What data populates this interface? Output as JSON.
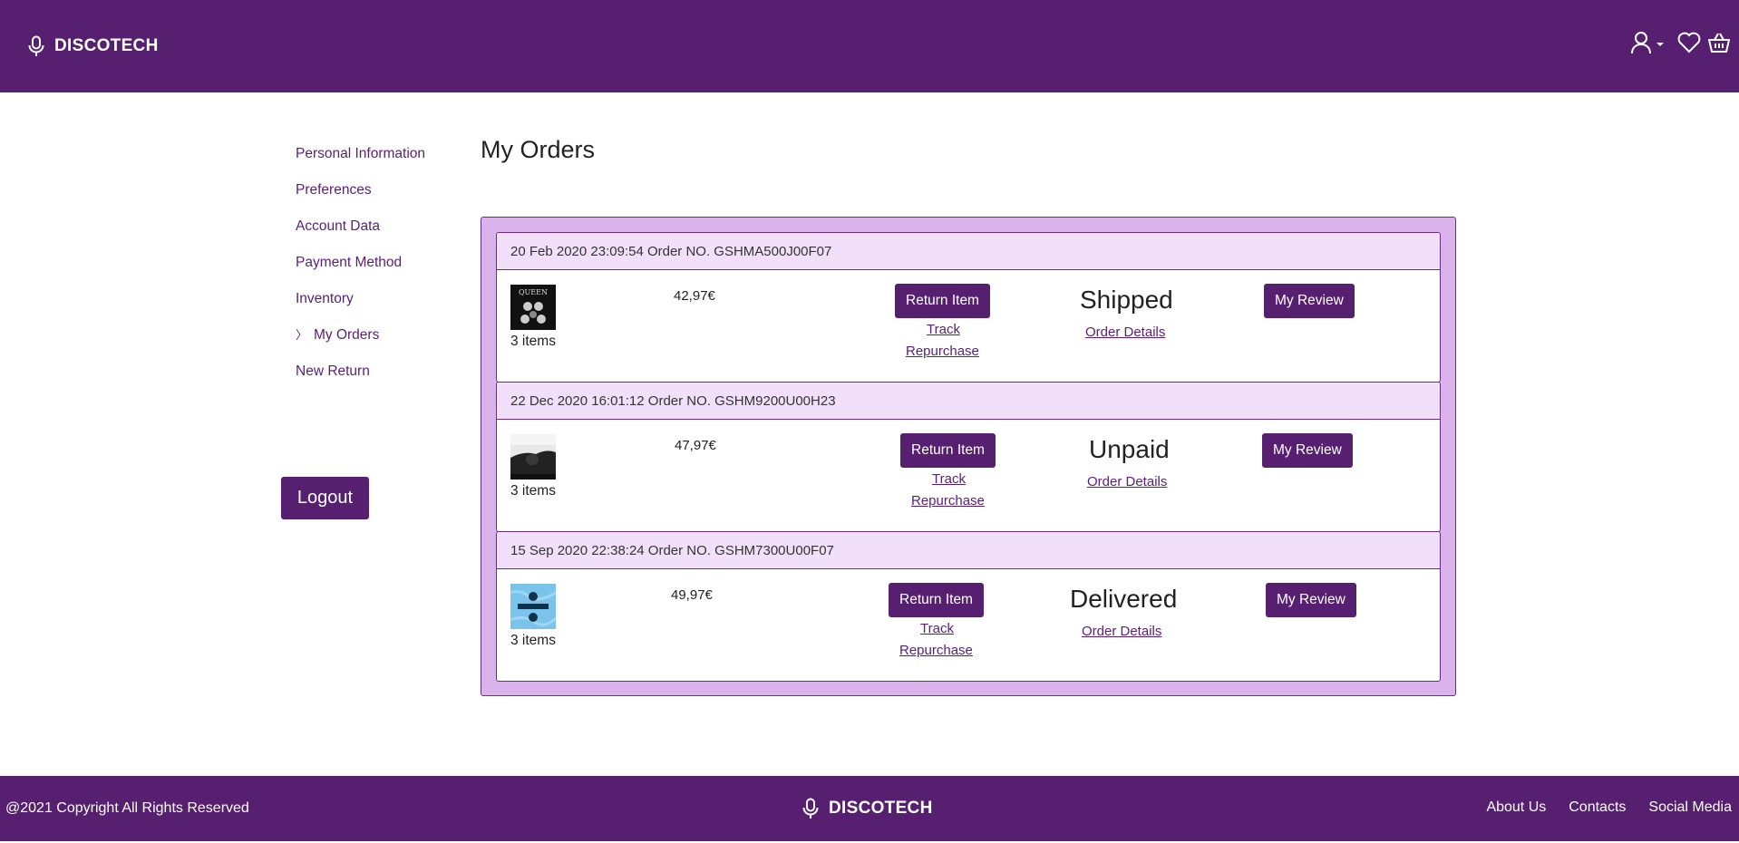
{
  "brand": {
    "name": "DISCOTECH"
  },
  "header": {
    "icons": [
      "user-icon",
      "chevron-down-icon",
      "heart-icon",
      "basket-icon"
    ]
  },
  "sidebar": {
    "items": [
      {
        "label": "Personal Information",
        "active": false
      },
      {
        "label": "Preferences",
        "active": false
      },
      {
        "label": "Account Data",
        "active": false
      },
      {
        "label": "Payment Method",
        "active": false
      },
      {
        "label": "Inventory",
        "active": false
      },
      {
        "label": "My Orders",
        "active": true
      },
      {
        "label": "New Return",
        "active": false
      }
    ],
    "active_marker": "〉",
    "logout_label": "Logout"
  },
  "main": {
    "title": "My Orders",
    "orders": [
      {
        "header": "20 Feb 2020 23:09:54 Order NO. GSHMA500J00F07",
        "items_count": "3 items",
        "price": "42,97€",
        "return_label": "Return Item",
        "track_label": "Track",
        "repurchase_label": "Repurchase",
        "status": "Shipped",
        "details_label": "Order Details",
        "review_label": "My Review",
        "thumb": "queen-album-cover"
      },
      {
        "header": "22 Dec 2020 16:01:12 Order NO. GSHM9200U00H23",
        "items_count": "3 items",
        "price": "47,97€",
        "return_label": "Return Item",
        "track_label": "Track",
        "repurchase_label": "Repurchase",
        "status": "Unpaid",
        "details_label": "Order Details",
        "review_label": "My Review",
        "thumb": "bw-album-cover"
      },
      {
        "header": "15 Sep 2020 22:38:24 Order NO. GSHM7300U00F07",
        "items_count": "3 items",
        "price": "49,97€",
        "return_label": "Return Item",
        "track_label": "Track",
        "repurchase_label": "Repurchase",
        "status": "Delivered",
        "details_label": "Order Details",
        "review_label": "My Review",
        "thumb": "divide-album-cover"
      }
    ]
  },
  "footer": {
    "copyright": "@2021 Copyright All Rights Reserved",
    "links": [
      "About Us",
      "Contacts",
      "Social Media"
    ]
  },
  "colors": {
    "primary": "#561f6f",
    "panel": "#dab2ec",
    "order_header": "#f2e0fa",
    "link": "#5a1f73"
  }
}
